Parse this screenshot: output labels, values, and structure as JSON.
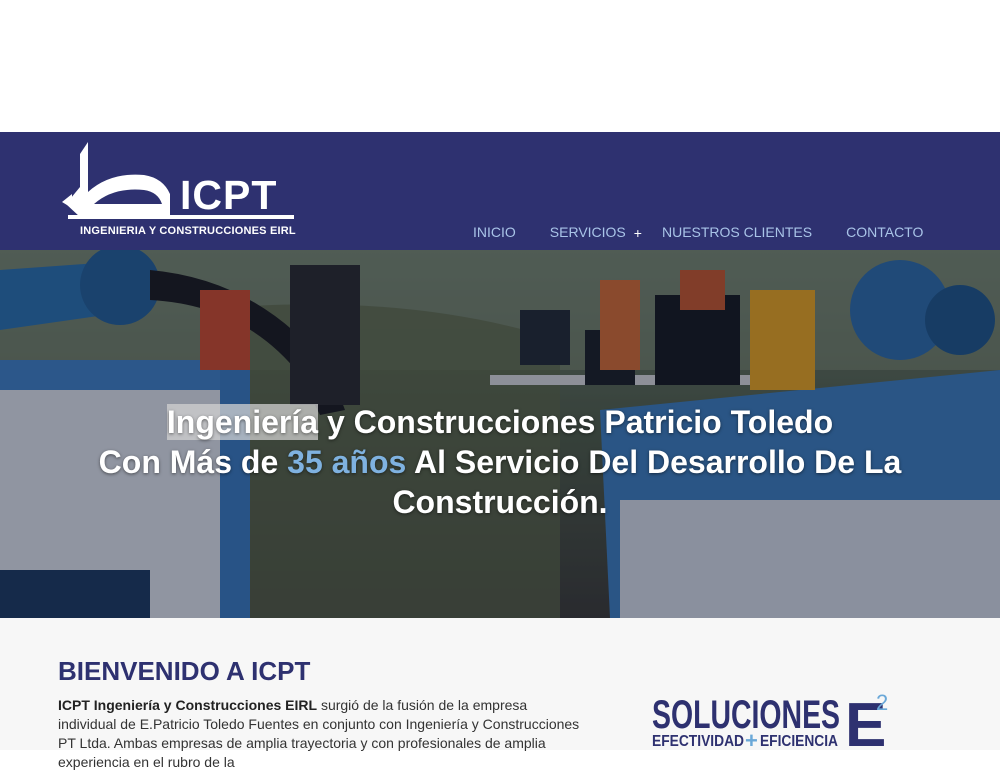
{
  "logo": {
    "brand": "ICPT",
    "tagline": "INGENIERIA Y CONSTRUCCIONES EIRL"
  },
  "nav": {
    "items": [
      {
        "label": "INICIO"
      },
      {
        "label": "SERVICIOS",
        "plus": "+"
      },
      {
        "label": "NUESTROS CLIENTES"
      },
      {
        "label": "CONTACTO"
      }
    ]
  },
  "hero": {
    "line1_highlight": "Ingeniería",
    "line1_rest": " y Construcciones Patricio Toledo",
    "line2_pre": "Con Más de ",
    "line2_accent": "35 años",
    "line2_post": " Al Servicio Del Desarrollo De La",
    "line3": "Construcción."
  },
  "welcome": {
    "title": "BIENVENIDO A ICPT",
    "company_bold": "ICPT Ingeniería y Construcciones EIRL",
    "body": " surgió de la fusión de la empresa individual de E.Patricio Toledo Fuentes en conjunto con Ingeniería y Construcciones PT Ltda. Ambas empresas de amplia trayectoria y con profesionales de amplia experiencia en el rubro de la"
  },
  "badge": {
    "word": "SOLUCIONES",
    "sub_left": "EFECTIVIDAD",
    "sub_plus": "+",
    "sub_right": "EFICIENCIA",
    "letter": "E",
    "sup": "2",
    "colors": {
      "navy": "#2e3170",
      "accent": "#6aa8d8"
    }
  },
  "colors": {
    "header_bg": "#2e3170",
    "nav_text": "#a9c4e8",
    "title_text": "#2e3170"
  }
}
